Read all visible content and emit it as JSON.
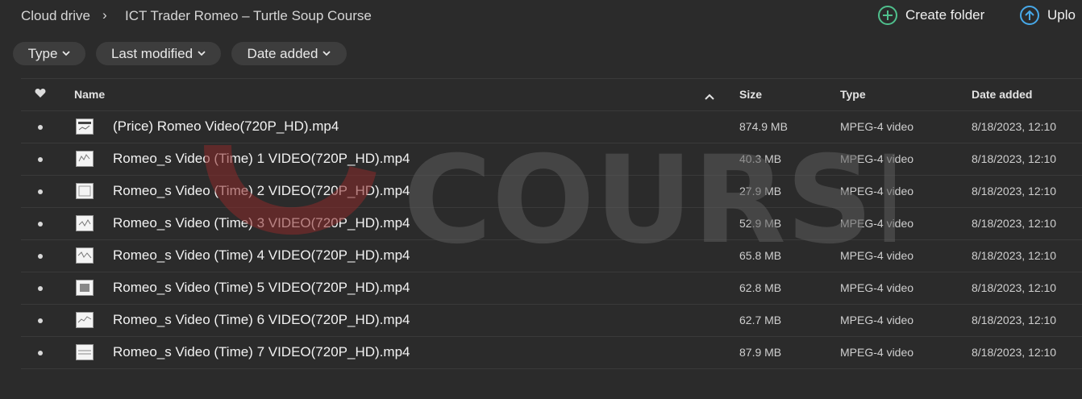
{
  "breadcrumb": {
    "root": "Cloud drive",
    "separator": "›",
    "current": "ICT Trader Romeo – Turtle Soup Course"
  },
  "actions": {
    "create_folder": "Create folder",
    "upload": "Uplo"
  },
  "filters": {
    "type": "Type",
    "last_modified": "Last modified",
    "date_added": "Date added"
  },
  "table": {
    "headers": {
      "name": "Name",
      "size": "Size",
      "type": "Type",
      "date_added": "Date added"
    },
    "rows": [
      {
        "name": "(Price) Romeo Video(720P_HD).mp4",
        "size": "874.9 MB",
        "type": "MPEG-4 video",
        "date": "8/18/2023, 12:10"
      },
      {
        "name": "Romeo_s Video (Time) 1 VIDEO(720P_HD).mp4",
        "size": "40.3 MB",
        "type": "MPEG-4 video",
        "date": "8/18/2023, 12:10"
      },
      {
        "name": "Romeo_s Video (Time) 2 VIDEO(720P_HD).mp4",
        "size": "27.9 MB",
        "type": "MPEG-4 video",
        "date": "8/18/2023, 12:10"
      },
      {
        "name": "Romeo_s Video (Time) 3 VIDEO(720P_HD).mp4",
        "size": "52.9 MB",
        "type": "MPEG-4 video",
        "date": "8/18/2023, 12:10"
      },
      {
        "name": "Romeo_s Video (Time) 4 VIDEO(720P_HD).mp4",
        "size": "65.8 MB",
        "type": "MPEG-4 video",
        "date": "8/18/2023, 12:10"
      },
      {
        "name": "Romeo_s Video (Time) 5 VIDEO(720P_HD).mp4",
        "size": "62.8 MB",
        "type": "MPEG-4 video",
        "date": "8/18/2023, 12:10"
      },
      {
        "name": "Romeo_s Video (Time) 6 VIDEO(720P_HD).mp4",
        "size": "62.7 MB",
        "type": "MPEG-4 video",
        "date": "8/18/2023, 12:10"
      },
      {
        "name": "Romeo_s Video (Time) 7 VIDEO(720P_HD).mp4",
        "size": "87.9 MB",
        "type": "MPEG-4 video",
        "date": "8/18/2023, 12:10"
      }
    ]
  },
  "watermark": {
    "text": "COURSE",
    "accent_color": "#8a2a2a",
    "text_color": "#5c5c5c"
  },
  "colors": {
    "background": "#2b2b2b",
    "create_icon": "#4fc08d",
    "upload_icon": "#47a8e8"
  },
  "icons": {
    "favourite": "heart-icon",
    "sort": "chevron-up-icon",
    "create": "plus-circle-icon",
    "upload": "arrow-up-circle-icon",
    "dropdown": "chevron-down-icon"
  }
}
